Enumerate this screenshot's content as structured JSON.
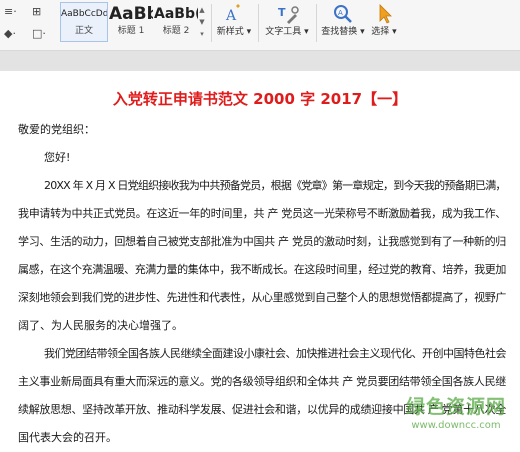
{
  "toolbar": {
    "styles": [
      {
        "sample": "AaBbCcDd",
        "label": "正文"
      },
      {
        "sample": "AaBb",
        "label": "标题 1"
      },
      {
        "sample": "AaBb(",
        "label": "标题 2"
      }
    ],
    "new_style_label": "新样式",
    "text_tools_label": "文字工具",
    "find_replace_label": "查找替换",
    "select_label": "选择",
    "accent_color": "#3b73c9"
  },
  "document": {
    "title": "入党转正申请书范文 2000 字 2017【一】",
    "title_color": "#e01b1b",
    "salutation": "敬爱的党组织：",
    "greeting": "您好!",
    "lines": [
      "20XX 年 X 月 X 日党组织接收我为中共预备党员，根据《党章》第一章规定，到今天我的预备期已满，",
      "我申请转为中共正式党员。在这近一年的时间里，共 产 党员这一光荣称号不断激励着我，成为我工作、",
      "学习、生活的动力，回想着自己被党支部批准为中国共 产 党员的激动时刻，让我感觉到有了一种新的归",
      "属感，在这个充满温暖、充满力量的集体中，我不断成长。在这段时间里，经过党的教育、培养，我更加",
      "深刻地领会到我们党的进步性、先进性和代表性，从心里感觉到自己整个人的思想觉悟都提高了，视野广",
      "阔了、为人民服务的决心增强了。",
      "我们党团结带领全国各族人民继续全面建设小康社会、加快推进社会主义现代化、开创中国特色社会",
      "主义事业新局面具有重大而深远的意义。党的各级领导组织和全体共 产 党员要团结带领全国各族人民继",
      "续解放思想、坚持改革开放、推动科学发展、促进社会和谐，以优异的成绩迎接中国共 产 党第十八次全",
      "国代表大会的召开。"
    ]
  },
  "watermark": {
    "title": "绿色资源网",
    "url": "www.downcc.com"
  }
}
